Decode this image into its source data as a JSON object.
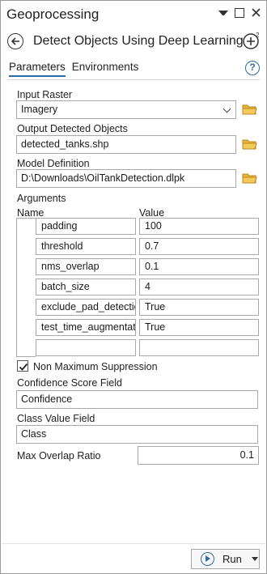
{
  "window": {
    "title": "Geoprocessing"
  },
  "tool": {
    "title": "Detect Objects Using Deep Learning"
  },
  "tabs": [
    {
      "label": "Parameters",
      "active": true
    },
    {
      "label": "Environments",
      "active": false
    }
  ],
  "help_glyph": "?",
  "params": {
    "input_raster": {
      "label": "Input Raster",
      "value": "Imagery"
    },
    "output_objects": {
      "label": "Output Detected Objects",
      "value": "detected_tanks.shp"
    },
    "model_definition": {
      "label": "Model Definition",
      "value": "D:\\Downloads\\OilTankDetection.dlpk"
    }
  },
  "arguments": {
    "label": "Arguments",
    "col_name": "Name",
    "col_value": "Value",
    "rows": [
      {
        "name": "padding",
        "value": "100"
      },
      {
        "name": "threshold",
        "value": "0.7"
      },
      {
        "name": "nms_overlap",
        "value": "0.1"
      },
      {
        "name": "batch_size",
        "value": "4"
      },
      {
        "name": "exclude_pad_detections",
        "value": "True"
      },
      {
        "name": "test_time_augmentation",
        "value": "True"
      },
      {
        "name": "",
        "value": ""
      }
    ]
  },
  "nms": {
    "label": "Non Maximum Suppression",
    "checked": true
  },
  "confidence": {
    "label": "Confidence Score Field",
    "value": "Confidence"
  },
  "class_field": {
    "label": "Class Value Field",
    "value": "Class"
  },
  "max_overlap": {
    "label": "Max Overlap Ratio",
    "value": "0.1"
  },
  "run": {
    "label": "Run"
  },
  "colors": {
    "accent": "#2d6ca2",
    "folder": "#e8b43a"
  }
}
